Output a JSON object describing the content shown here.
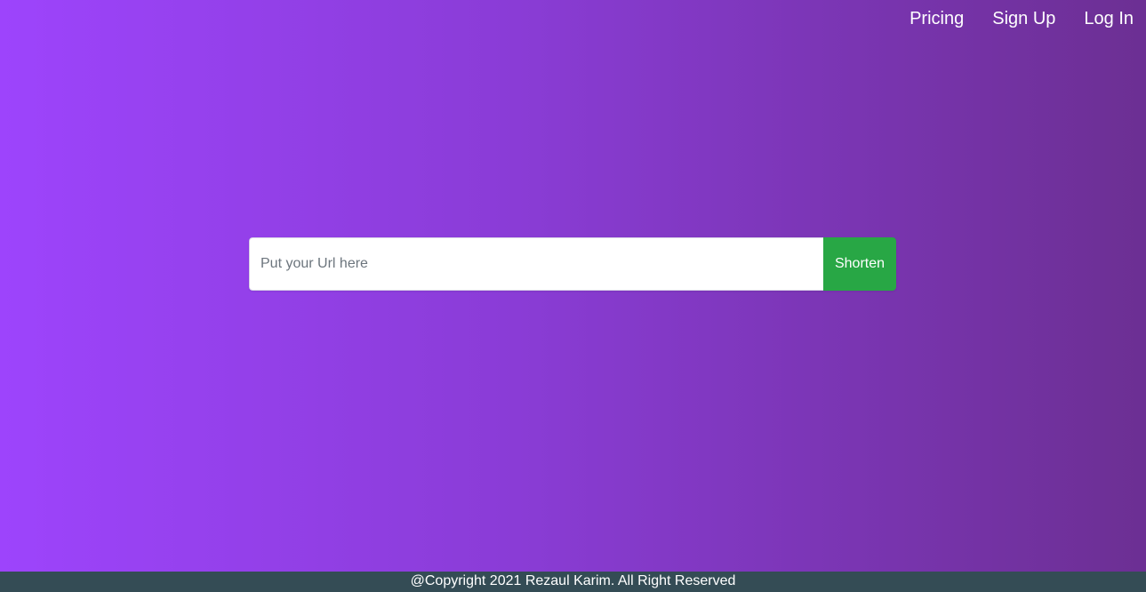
{
  "nav": {
    "items": [
      {
        "label": "Pricing"
      },
      {
        "label": "Sign Up"
      },
      {
        "label": "Log In"
      }
    ]
  },
  "form": {
    "url_placeholder": "Put your Url here",
    "url_value": "",
    "submit_label": "Shorten"
  },
  "footer": {
    "copyright": "@Copyright 2021 Rezaul Karim. All Right Reserved"
  },
  "colors": {
    "gradient_start": "#9d44fc",
    "gradient_end": "#6c2f93",
    "button": "#28a745",
    "footer_bg": "#344c55"
  }
}
